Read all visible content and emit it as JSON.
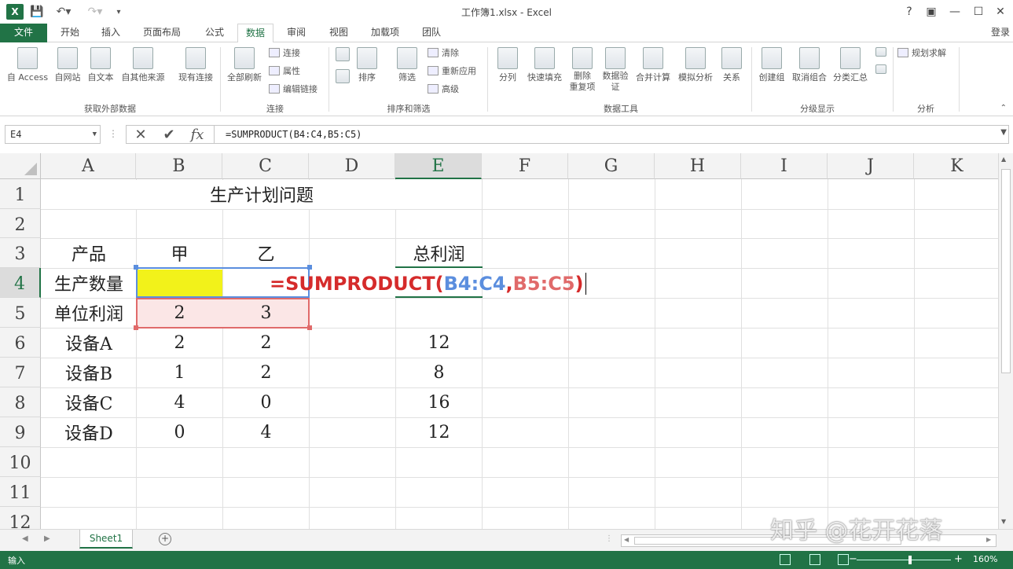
{
  "window": {
    "title": "工作簿1.xlsx - Excel",
    "app_icon": "X",
    "help": "?",
    "login": "登录"
  },
  "tabs": [
    "文件",
    "开始",
    "插入",
    "页面布局",
    "公式",
    "数据",
    "审阅",
    "视图",
    "加载项",
    "团队"
  ],
  "active_tab": "数据",
  "ribbon": {
    "groups": [
      {
        "name": "获取外部数据",
        "buttons": [
          "自 Access",
          "自网站",
          "自文本",
          "自其他来源",
          "现有连接"
        ]
      },
      {
        "name": "连接",
        "buttons": [
          "全部刷新"
        ],
        "small": [
          "连接",
          "属性",
          "编辑链接"
        ]
      },
      {
        "name": "排序和筛选",
        "buttons": [
          "排序",
          "筛选"
        ],
        "small": [
          "清除",
          "重新应用",
          "高级"
        ]
      },
      {
        "name": "数据工具",
        "buttons": [
          "分列",
          "快速填充",
          "删除\n重复项",
          "数据验\n证",
          "合并计算",
          "模拟分析",
          "关系"
        ]
      },
      {
        "name": "分级显示",
        "buttons": [
          "创建组",
          "取消组合",
          "分类汇总"
        ]
      },
      {
        "name": "分析",
        "small": [
          "规划求解"
        ]
      }
    ]
  },
  "formula_bar": {
    "name_box": "E4",
    "formula": "=SUMPRODUCT(B4:C4,B5:C5)"
  },
  "columns": [
    "A",
    "B",
    "C",
    "D",
    "E",
    "F",
    "G",
    "H",
    "I",
    "J",
    "K"
  ],
  "selected_column": "E",
  "rows": [
    "1",
    "2",
    "3",
    "4",
    "5",
    "6",
    "7",
    "8",
    "9",
    "10",
    "11",
    "12"
  ],
  "selected_row": "4",
  "sheet": {
    "title": "生产计划问题",
    "header_row": {
      "label": "产品",
      "b": "甲",
      "c": "乙",
      "e": "总利润"
    },
    "row4": {
      "label": "生产数量",
      "b": "",
      "c": ""
    },
    "row5": {
      "label": "单位利润",
      "b": "2",
      "c": "3"
    },
    "devices": [
      {
        "label": "设备A",
        "b": "2",
        "c": "2",
        "e": "12"
      },
      {
        "label": "设备B",
        "b": "1",
        "c": "2",
        "e": "8"
      },
      {
        "label": "设备C",
        "b": "4",
        "c": "0",
        "e": "16"
      },
      {
        "label": "设备D",
        "b": "0",
        "c": "4",
        "e": "12"
      }
    ],
    "incell_formula": {
      "p1": "=SUMPRODUCT(",
      "p2": "B4:C4",
      "p3": ",",
      "p4": "B5:C5",
      "p5": ")"
    }
  },
  "sheet_tabs": [
    "Sheet1"
  ],
  "status": {
    "mode": "输入",
    "zoom": "160%"
  },
  "watermark": "知乎 @花开花落",
  "colors": {
    "excel_green": "#217346",
    "ref_blue": "#5b8ede",
    "ref_red": "#e06a6a",
    "formula_red": "#d52b2b",
    "highlight_yellow": "#f2f21a"
  }
}
